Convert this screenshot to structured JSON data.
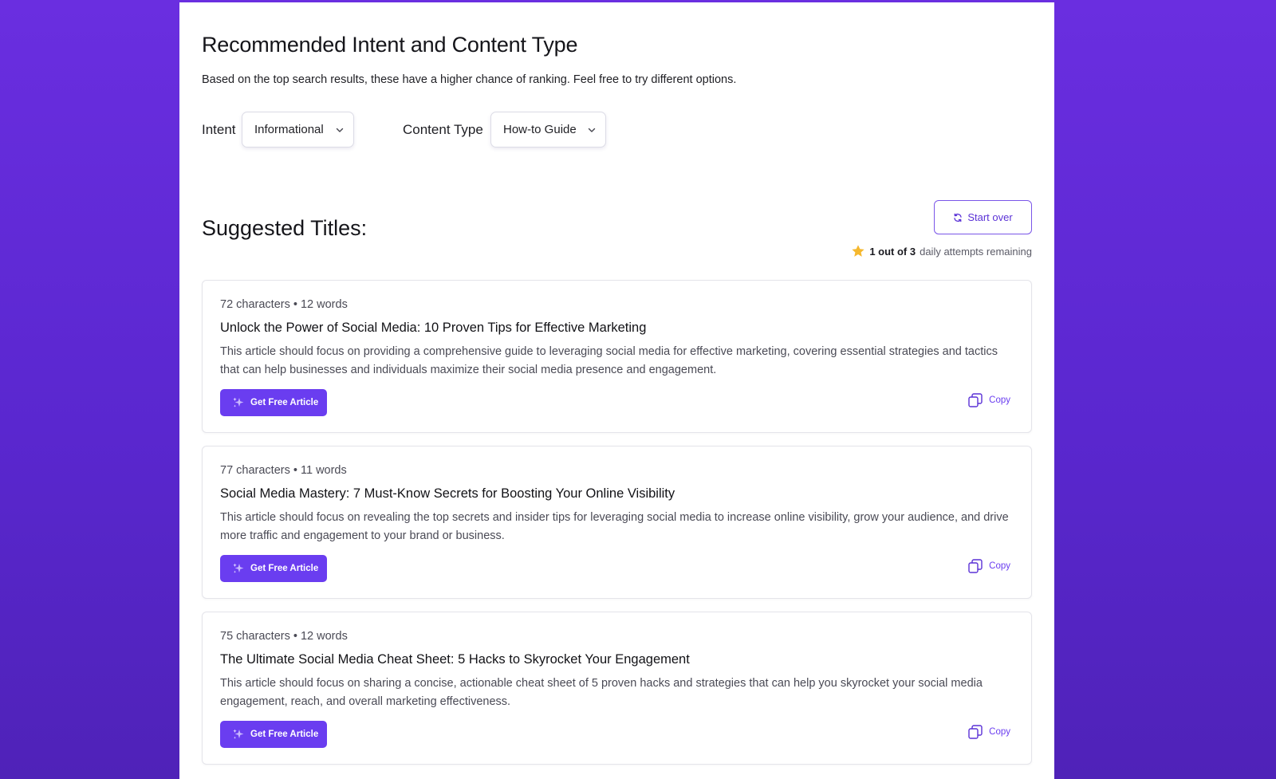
{
  "header": {
    "title": "Recommended Intent and Content Type",
    "subtitle": "Based on the top search results, these have a higher chance of ranking. Feel free to try different options."
  },
  "filters": {
    "intent_label": "Intent",
    "intent_value": "Informational",
    "content_type_label": "Content Type",
    "content_type_value": "How-to Guide"
  },
  "suggestions": {
    "heading": "Suggested Titles:",
    "start_over_label": "Start over",
    "attempts": {
      "used": "1 out of 3",
      "suffix": "daily attempts remaining"
    },
    "get_button_label": "Get Free Article",
    "copy_label": "Copy",
    "items": [
      {
        "meta": "72 characters • 12 words",
        "title": "Unlock the Power of Social Media: 10 Proven Tips for Effective Marketing",
        "description": "This article should focus on providing a comprehensive guide to leveraging social media for effective marketing, covering essential strategies and tactics that can help businesses and individuals maximize their social media presence and engagement."
      },
      {
        "meta": "77 characters • 11 words",
        "title": "Social Media Mastery: 7 Must-Know Secrets for Boosting Your Online Visibility",
        "description": "This article should focus on revealing the top secrets and insider tips for leveraging social media to increase online visibility, grow your audience, and drive more traffic and engagement to your brand or business."
      },
      {
        "meta": "75 characters • 12 words",
        "title": "The Ultimate Social Media Cheat Sheet: 5 Hacks to Skyrocket Your Engagement",
        "description": "This article should focus on sharing a concise, actionable cheat sheet of 5 proven hacks and strategies that can help you skyrocket your social media engagement, reach, and overall marketing effectiveness."
      }
    ]
  },
  "colors": {
    "background": "#6a2ee0",
    "accent": "#6a3df0",
    "star": "#f5b82e"
  },
  "icons": [
    "chevron-down-icon",
    "refresh-icon",
    "star-icon",
    "sparkle-icon",
    "copy-icon"
  ]
}
